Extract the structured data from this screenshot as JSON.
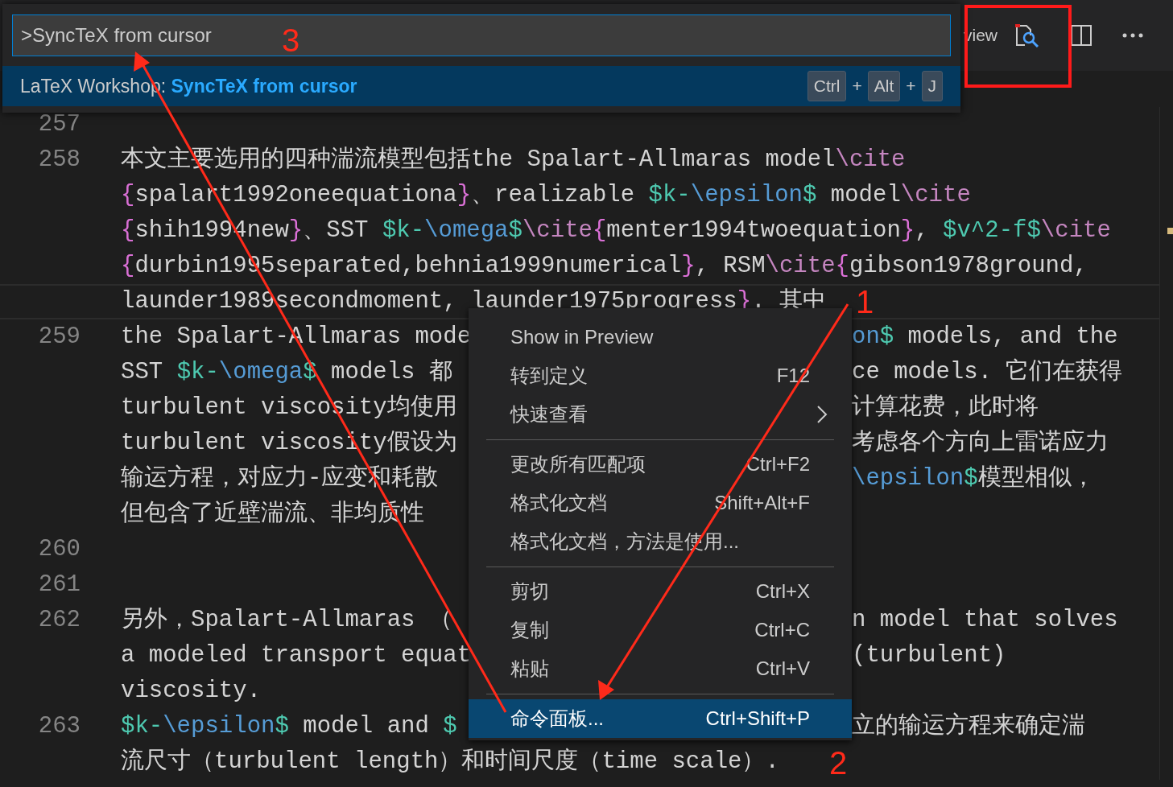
{
  "command_palette": {
    "input": {
      "value": ">SyncTeX from cursor"
    },
    "results": [
      {
        "label": "LaTeX Workshop: **SyncTeX from cursor**",
        "selected": true,
        "keys": [
          "Ctrl",
          "Alt",
          "J"
        ],
        "joiners": [
          "+",
          "+"
        ]
      }
    ]
  },
  "editor_toolbar": {
    "label": "view"
  },
  "editor": {
    "lines": [
      {
        "number": "257",
        "rows": [
          {
            "current": false,
            "left": []
          }
        ]
      },
      {
        "number": "258",
        "rows": [
          {
            "current": false,
            "left": [
              {
                "kind": "text",
                "text": "本文主要选用的四种湍流模型包括the Spalart-Allmaras model"
              },
              {
                "kind": "cmd",
                "text": "\\cite"
              }
            ]
          },
          {
            "current": false,
            "left": [
              {
                "kind": "brace",
                "text": "{"
              },
              {
                "kind": "text",
                "text": "spalart1992oneequationa"
              },
              {
                "kind": "brace",
                "text": "}"
              },
              {
                "kind": "text",
                "text": "、realizable "
              },
              {
                "kind": "math",
                "text": "$k-"
              },
              {
                "kind": "mathcmd",
                "text": "\\epsilon"
              },
              {
                "kind": "math",
                "text": "$"
              },
              {
                "kind": "text",
                "text": " model"
              },
              {
                "kind": "cmd",
                "text": "\\cite"
              }
            ]
          },
          {
            "current": false,
            "left": [
              {
                "kind": "brace",
                "text": "{"
              },
              {
                "kind": "text",
                "text": "shih1994new"
              },
              {
                "kind": "brace",
                "text": "}"
              },
              {
                "kind": "text",
                "text": "、SST "
              },
              {
                "kind": "math",
                "text": "$k-"
              },
              {
                "kind": "mathcmd",
                "text": "\\omega"
              },
              {
                "kind": "math",
                "text": "$"
              },
              {
                "kind": "cmd",
                "text": "\\cite"
              },
              {
                "kind": "brace",
                "text": "{"
              },
              {
                "kind": "text",
                "text": "menter1994twoequation"
              },
              {
                "kind": "brace",
                "text": "}"
              },
              {
                "kind": "text",
                "text": ", "
              },
              {
                "kind": "math",
                "text": "$v^2-f$"
              },
              {
                "kind": "cmd",
                "text": "\\cite"
              }
            ]
          },
          {
            "current": false,
            "left": [
              {
                "kind": "brace",
                "text": "{"
              },
              {
                "kind": "text",
                "text": "durbin1995separated,behnia1999numerical"
              },
              {
                "kind": "brace",
                "text": "}"
              },
              {
                "kind": "text",
                "text": ", RSM"
              },
              {
                "kind": "cmd",
                "text": "\\cite"
              },
              {
                "kind": "brace",
                "text": "{"
              },
              {
                "kind": "text",
                "text": "gibson1978ground,"
              }
            ]
          },
          {
            "current": true,
            "left": [
              {
                "kind": "text",
                "text": "launder1989secondmoment, launder1975progress"
              },
              {
                "kind": "brace",
                "text": "}"
              },
              {
                "kind": "text",
                "text": ". 其中"
              }
            ]
          }
        ]
      },
      {
        "number": "259",
        "rows": [
          {
            "current": false,
            "left": [
              {
                "kind": "text",
                "text": "the Spalart-Allmaras mode"
              }
            ],
            "right": [
              {
                "kind": "mathcmd",
                "text": "on"
              },
              {
                "kind": "math",
                "text": "$"
              },
              {
                "kind": "text",
                "text": " models, and the"
              }
            ]
          },
          {
            "current": false,
            "left": [
              {
                "kind": "text",
                "text": "SST "
              },
              {
                "kind": "math",
                "text": "$k-"
              },
              {
                "kind": "mathcmd",
                "text": "\\omega"
              },
              {
                "kind": "math",
                "text": "$"
              },
              {
                "kind": "text",
                "text": " models 都"
              }
            ],
            "right": [
              {
                "kind": "text",
                "text": "ce models. 它们在获得"
              }
            ]
          },
          {
            "current": false,
            "left": [
              {
                "kind": "text",
                "text": "turbulent viscosity均使用"
              }
            ],
            "right": [
              {
                "kind": "text",
                "text": "计算花费，此时将"
              }
            ]
          },
          {
            "current": false,
            "left": [
              {
                "kind": "text",
                "text": "turbulent viscosity假设为"
              }
            ],
            "right": [
              {
                "kind": "text",
                "text": "考虑各个方向上雷诺应力"
              }
            ]
          },
          {
            "current": false,
            "left": [
              {
                "kind": "text",
                "text": "输运方程，对应力-应变和耗散"
              }
            ],
            "right": [
              {
                "kind": "mathcmd",
                "text": "\\epsilon"
              },
              {
                "kind": "math",
                "text": "$"
              },
              {
                "kind": "text",
                "text": "模型相似，"
              }
            ]
          },
          {
            "current": false,
            "left": [
              {
                "kind": "text",
                "text": "但包含了近壁湍流、非均质性"
              }
            ]
          }
        ]
      },
      {
        "number": "260",
        "rows": [
          {
            "current": false,
            "left": []
          }
        ]
      },
      {
        "number": "261",
        "rows": [
          {
            "current": false,
            "left": []
          }
        ]
      },
      {
        "number": "262",
        "rows": [
          {
            "current": false,
            "left": [
              {
                "kind": "text",
                "text": "另外，Spalart-Allmaras （"
              }
            ],
            "right": [
              {
                "kind": "text",
                "text": "n model that solves"
              }
            ]
          },
          {
            "current": false,
            "left": [
              {
                "kind": "text",
                "text": "a modeled transport equat"
              }
            ],
            "right": [
              {
                "kind": "text",
                "text": "(turbulent)"
              }
            ]
          },
          {
            "current": false,
            "left": [
              {
                "kind": "text",
                "text": "viscosity."
              }
            ]
          }
        ]
      },
      {
        "number": "263",
        "rows": [
          {
            "current": false,
            "left": [
              {
                "kind": "math",
                "text": "$k-"
              },
              {
                "kind": "mathcmd",
                "text": "\\epsilon"
              },
              {
                "kind": "math",
                "text": "$"
              },
              {
                "kind": "text",
                "text": " model and "
              },
              {
                "kind": "math",
                "text": "$"
              }
            ],
            "right": [
              {
                "kind": "text",
                "text": "立的输运方程来确定湍"
              }
            ]
          },
          {
            "current": false,
            "left": [
              {
                "kind": "text",
                "text": "流尺寸（turbulent length）和时间尺度（time scale）."
              }
            ]
          }
        ]
      }
    ]
  },
  "context_menu": {
    "items": [
      {
        "kind": "item",
        "label": "Show in Preview",
        "selected": false,
        "submenu": false
      },
      {
        "kind": "item",
        "label": "转到定义",
        "shortcut": "F12",
        "selected": false,
        "submenu": false
      },
      {
        "kind": "item",
        "label": "快速查看",
        "selected": false,
        "submenu": true
      },
      {
        "kind": "separator"
      },
      {
        "kind": "item",
        "label": "更改所有匹配项",
        "shortcut": "Ctrl+F2",
        "selected": false,
        "submenu": false
      },
      {
        "kind": "item",
        "label": "格式化文档",
        "shortcut": "Shift+Alt+F",
        "selected": false,
        "submenu": false
      },
      {
        "kind": "item",
        "label": "格式化文档，方法是使用...",
        "selected": false,
        "submenu": false
      },
      {
        "kind": "separator"
      },
      {
        "kind": "item",
        "label": "剪切",
        "shortcut": "Ctrl+X",
        "selected": false,
        "submenu": false
      },
      {
        "kind": "item",
        "label": "复制",
        "shortcut": "Ctrl+C",
        "selected": false,
        "submenu": false
      },
      {
        "kind": "item",
        "label": "粘贴",
        "shortcut": "Ctrl+V",
        "selected": false,
        "submenu": false
      },
      {
        "kind": "separator"
      },
      {
        "kind": "item",
        "label": "命令面板...",
        "shortcut": "Ctrl+Shift+P",
        "selected": true,
        "submenu": false
      }
    ]
  },
  "annotations": {
    "markers": [
      {
        "label": "1"
      },
      {
        "label": "2"
      },
      {
        "label": "3"
      }
    ]
  }
}
